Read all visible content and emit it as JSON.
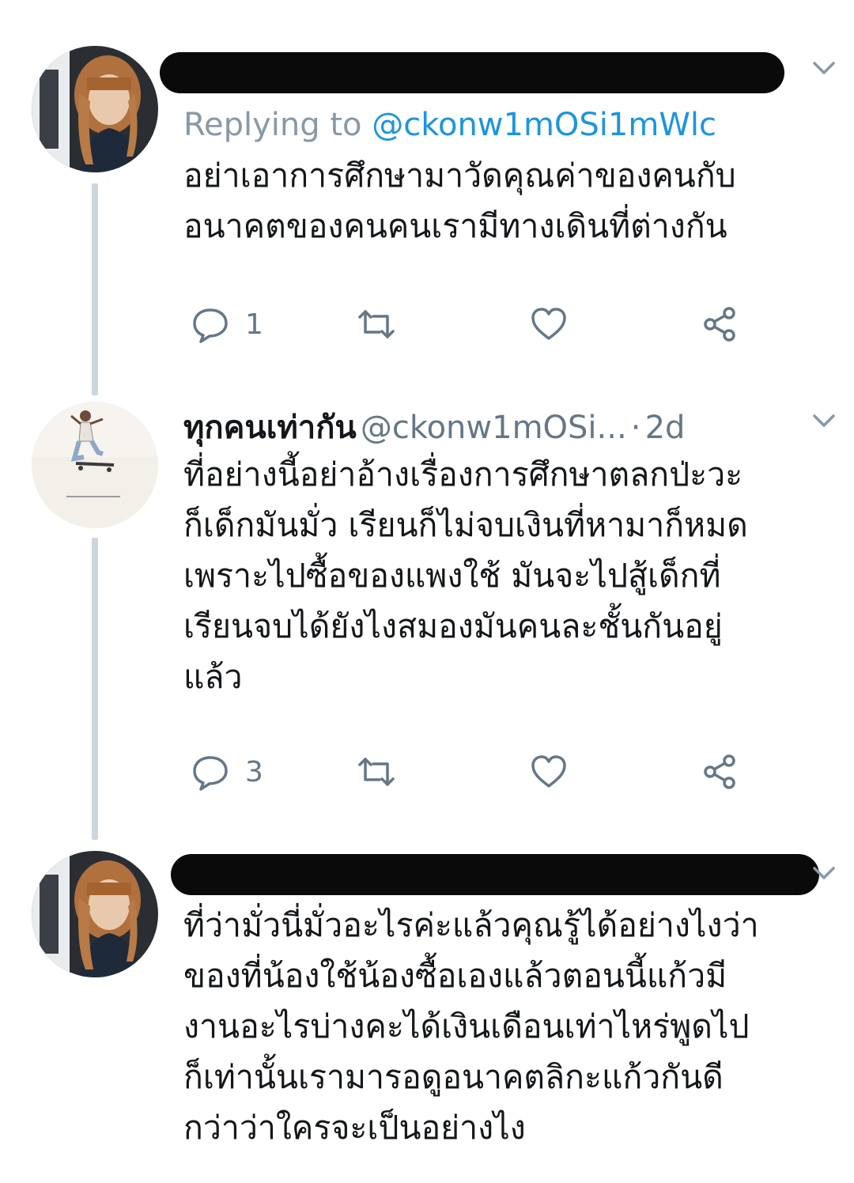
{
  "tweets": [
    {
      "replying_prefix": "Replying to",
      "replying_handle": "@ckonw1mOSi1mWlc",
      "text": "อย่าเอาการศึกษามาวัดคุณค่าของคนกับ\nอนาคตของคนคนเรามีทางเดินที่ต่างกัน",
      "reply_count": "1",
      "icons": [
        "reply-icon",
        "retweet-icon",
        "like-icon",
        "share-icon"
      ]
    },
    {
      "name": "ทุกคนเท่ากัน",
      "handle": "@ckonw1mOSi...",
      "separator": "·",
      "time": "2d",
      "text": "ที่อย่างนี้อย่าอ้างเรื่องการศึกษาตลกป่ะวะ\nก็เด็กมันมั่ว เรียนก็ไม่จบเงินที่หามาก็หมด\nเพราะไปซื้อของแพงใช้ มันจะไปสู้เด็กที่\nเรียนจบได้ยังไงสมองมันคนละชั้นกันอยู่\nแล้ว",
      "reply_count": "3",
      "icons": [
        "reply-icon",
        "retweet-icon",
        "like-icon",
        "share-icon"
      ]
    },
    {
      "text": "ที่ว่ามั่วนี่มั่วอะไรค่ะแล้วคุณรู้ได้อย่างไงว่า\nของที่น้องใช้น้องซื้อเองแล้วตอนนี้แก้วมี\nงานอะไรบ่างคะได้เงินเดือนเท่าไหร่พูดไป\nก็เท่านั้นเรามารอดูอนาคตลิกะแก้วกันดี\nกว่าว่าใครจะเป็นอย่างไง"
    }
  ],
  "colors": {
    "text": "#14171a",
    "secondary": "#657786",
    "mention": "#1b95e0",
    "thread_line": "#ccd6dd",
    "redaction": "#0a0a0a"
  }
}
